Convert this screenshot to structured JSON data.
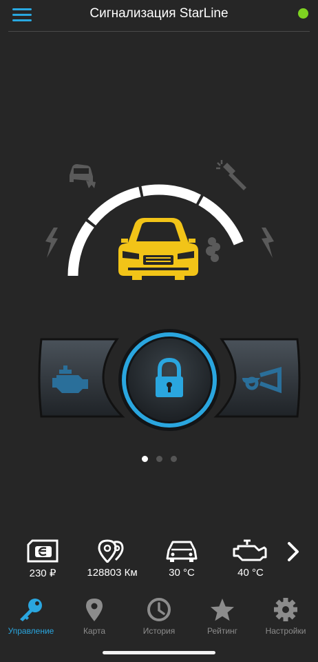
{
  "header": {
    "title": "Сигнализация StarLine",
    "menu_icon": "hamburger-icon",
    "status_color": "#7ed321"
  },
  "colors": {
    "accent": "#2aa6df",
    "car": "#f2c418",
    "background": "#262626"
  },
  "status_icons": [
    "crash-car-icon",
    "hammer-icon",
    "shock-left-icon",
    "shock-right-icon",
    "car-icon",
    "smoke-icon"
  ],
  "controls": {
    "left": "engine-icon",
    "center": "lock-icon",
    "right": "horn-icon"
  },
  "pager": {
    "pages": 3,
    "active": 1
  },
  "info": {
    "items": [
      {
        "icon": "balance-card-icon",
        "value": "230 ₽"
      },
      {
        "icon": "mileage-pin-icon",
        "value": "128803 Км"
      },
      {
        "icon": "car-temp-icon",
        "value": "30 °C"
      },
      {
        "icon": "engine-temp-icon",
        "value": "40 °C"
      }
    ]
  },
  "tabs": [
    {
      "label": "Управление",
      "icon": "key-icon",
      "active": true
    },
    {
      "label": "Карта",
      "icon": "map-pin-icon",
      "active": false
    },
    {
      "label": "История",
      "icon": "clock-icon",
      "active": false
    },
    {
      "label": "Рейтинг",
      "icon": "star-icon",
      "active": false
    },
    {
      "label": "Настройки",
      "icon": "gear-icon",
      "active": false
    }
  ]
}
